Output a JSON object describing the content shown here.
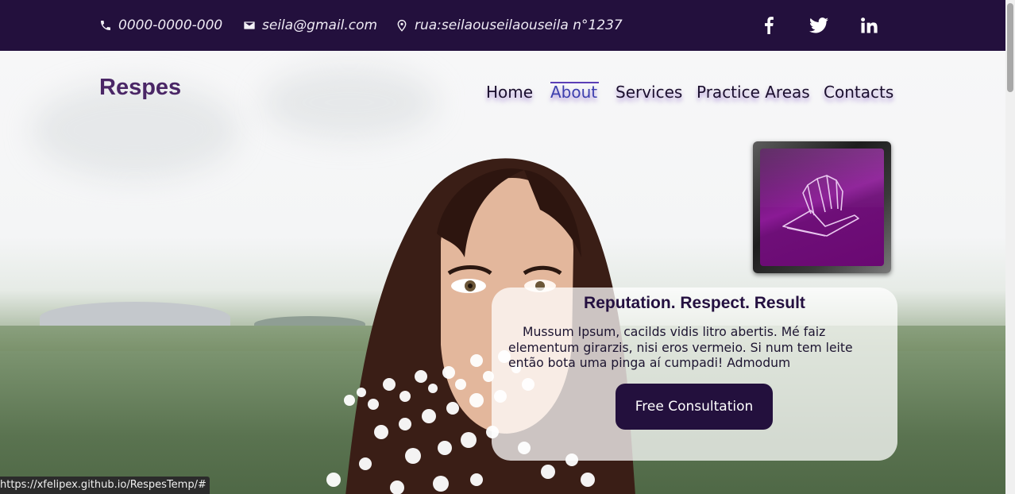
{
  "topbar": {
    "phone": "0000-0000-000",
    "email": "seila@gmail.com",
    "address": "rua:seilaouseilaouseila n°1237",
    "social": [
      {
        "icon": "facebook-icon",
        "glyph": "f"
      },
      {
        "icon": "twitter-icon",
        "glyph": "🐦"
      },
      {
        "icon": "linkedin-icon",
        "glyph": "in"
      }
    ]
  },
  "brand": "Respes",
  "nav": {
    "items": [
      "Home",
      "About",
      "Services",
      "Practice Areas",
      "Contacts"
    ],
    "active": "About"
  },
  "hero": {
    "title": "Reputation. Respect. Result",
    "body": "Mussum Ipsum, cacilds vidis litro abertis. Mé faiz elementum girarzis, nisi eros vermeio. Si num tem leite então bota uma pinga aí cumpadi! Admodum",
    "cta": "Free Consultation"
  },
  "status_url": "https://xfelipex.github.io/RespesTemp/#",
  "colors": {
    "topbar": "#23103d",
    "brand": "#4a2666",
    "accent": "#5b3fb7",
    "badge": "#8a1a95"
  }
}
